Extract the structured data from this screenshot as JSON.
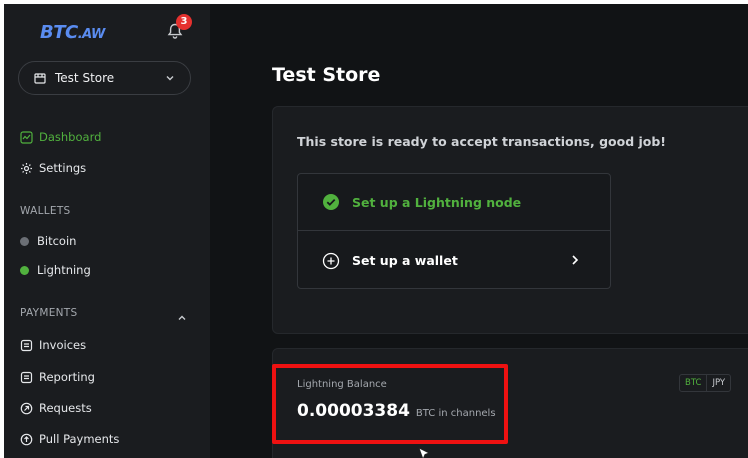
{
  "sidebar": {
    "logo_main": "BTC",
    "logo_suffix": ".AW",
    "notifications_count": "3",
    "store_selector": "Test Store",
    "nav": [
      {
        "label": "Dashboard"
      },
      {
        "label": "Settings"
      }
    ],
    "wallets_heading": "WALLETS",
    "wallets": [
      {
        "label": "Bitcoin"
      },
      {
        "label": "Lightning"
      }
    ],
    "payments_heading": "PAYMENTS",
    "payments": [
      {
        "label": "Invoices"
      },
      {
        "label": "Reporting"
      },
      {
        "label": "Requests"
      },
      {
        "label": "Pull Payments"
      }
    ]
  },
  "main": {
    "page_title": "Test Store",
    "ready_message": "This store is ready to accept transactions, good job!",
    "steps": [
      {
        "label": "Set up a Lightning node",
        "status": "done"
      },
      {
        "label": "Set up a wallet",
        "status": "todo"
      }
    ],
    "balance": {
      "label": "Lightning Balance",
      "value": "0.00003384",
      "unit": "BTC in channels",
      "currency_options": [
        "BTC",
        "JPY"
      ],
      "selected_currency": "BTC"
    }
  },
  "colors": {
    "accent_green": "#51b13e",
    "brand_blue": "#5a8cf0",
    "badge_red": "#e5312f",
    "highlight_red": "#ee1111"
  }
}
